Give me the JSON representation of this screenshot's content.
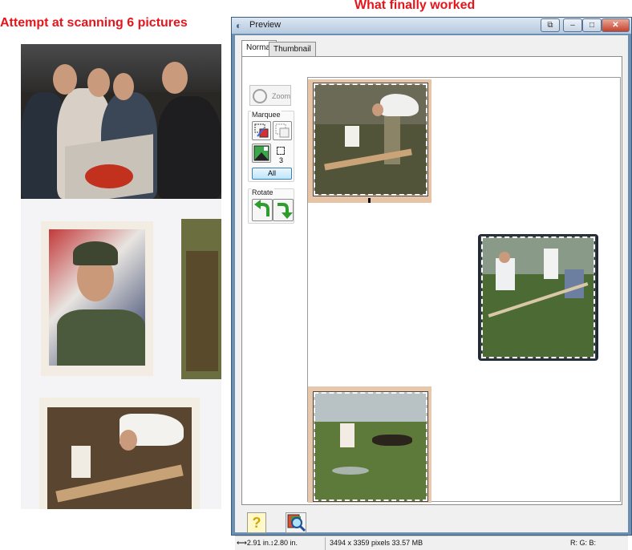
{
  "captions": {
    "left": "Attempt at scanning 6 pictures",
    "right": "What finally worked"
  },
  "window": {
    "title": "Preview",
    "buttons": {
      "restore": "⧉",
      "minimize": "–",
      "maximize": "□",
      "close": "✕"
    }
  },
  "tabs": [
    {
      "label": "Normal",
      "active": true
    },
    {
      "label": "Thumbnail",
      "active": false
    }
  ],
  "tools": {
    "zoom_label": "Zoom",
    "marquee_title": "Marquee",
    "marquee_count": "3",
    "all_label": "All",
    "rotate_title": "Rotate"
  },
  "icons": {
    "help": "?",
    "rotate_left": "↶",
    "rotate_right": "↷"
  },
  "status": {
    "width": "2.91 in.",
    "height": "2.80 in.",
    "pixels": "3494 x 3359 pixels 33.57 MB",
    "rgb": "R:  G:  B:"
  },
  "colors": {
    "caption_red": "#e8141b",
    "window_frame": "#6b8fb2",
    "all_button": "#bee6fd"
  }
}
